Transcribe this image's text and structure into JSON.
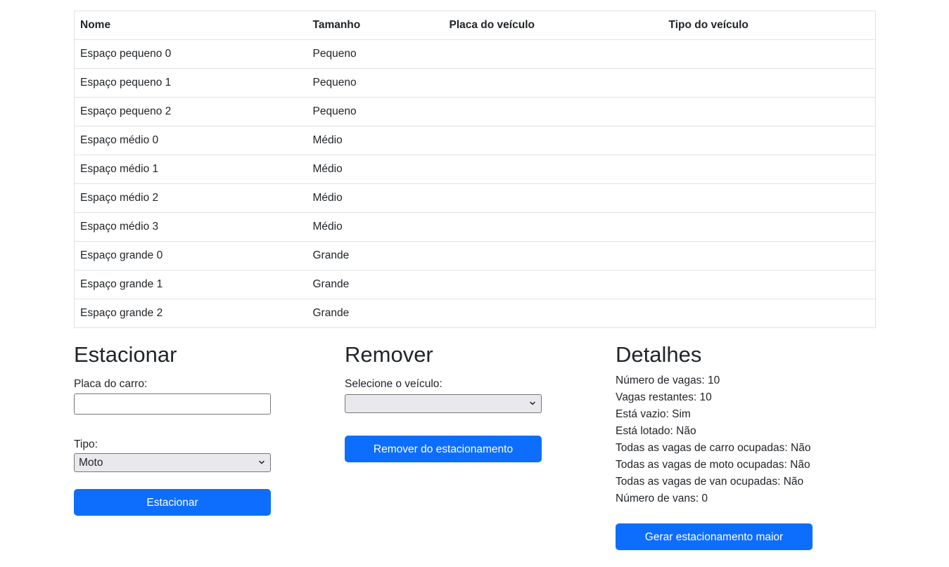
{
  "table": {
    "headers": {
      "nome": "Nome",
      "tamanho": "Tamanho",
      "placa": "Placa do veículo",
      "tipo": "Tipo do veículo"
    },
    "rows": [
      {
        "nome": "Espaço pequeno 0",
        "tamanho": "Pequeno",
        "placa": "",
        "tipo": ""
      },
      {
        "nome": "Espaço pequeno 1",
        "tamanho": "Pequeno",
        "placa": "",
        "tipo": ""
      },
      {
        "nome": "Espaço pequeno 2",
        "tamanho": "Pequeno",
        "placa": "",
        "tipo": ""
      },
      {
        "nome": "Espaço médio 0",
        "tamanho": "Médio",
        "placa": "",
        "tipo": ""
      },
      {
        "nome": "Espaço médio 1",
        "tamanho": "Médio",
        "placa": "",
        "tipo": ""
      },
      {
        "nome": "Espaço médio 2",
        "tamanho": "Médio",
        "placa": "",
        "tipo": ""
      },
      {
        "nome": "Espaço médio 3",
        "tamanho": "Médio",
        "placa": "",
        "tipo": ""
      },
      {
        "nome": "Espaço grande 0",
        "tamanho": "Grande",
        "placa": "",
        "tipo": ""
      },
      {
        "nome": "Espaço grande 1",
        "tamanho": "Grande",
        "placa": "",
        "tipo": ""
      },
      {
        "nome": "Espaço grande 2",
        "tamanho": "Grande",
        "placa": "",
        "tipo": ""
      }
    ]
  },
  "park": {
    "title": "Estacionar",
    "plate_label": "Placa do carro:",
    "plate_value": "",
    "type_label": "Tipo:",
    "type_selected": "Moto",
    "button": "Estacionar"
  },
  "remove": {
    "title": "Remover",
    "select_label": "Selecione o veículo:",
    "select_value": "",
    "button": "Remover do estacionamento"
  },
  "details": {
    "title": "Detalhes",
    "lines": [
      "Número de vagas: 10",
      "Vagas restantes: 10",
      "Está vazio: Sim",
      "Está lotado: Não",
      "Todas as vagas de carro ocupadas: Não",
      "Todas as vagas de moto ocupadas: Não",
      "Todas as vagas de van ocupadas: Não",
      "Número de vans: 0"
    ],
    "button": "Gerar estacionamento maior"
  },
  "icons": {
    "dropdown": "chevron-down-icon"
  },
  "colors": {
    "primary": "#0d6efd",
    "text": "#212529",
    "border": "#dee2e6"
  }
}
